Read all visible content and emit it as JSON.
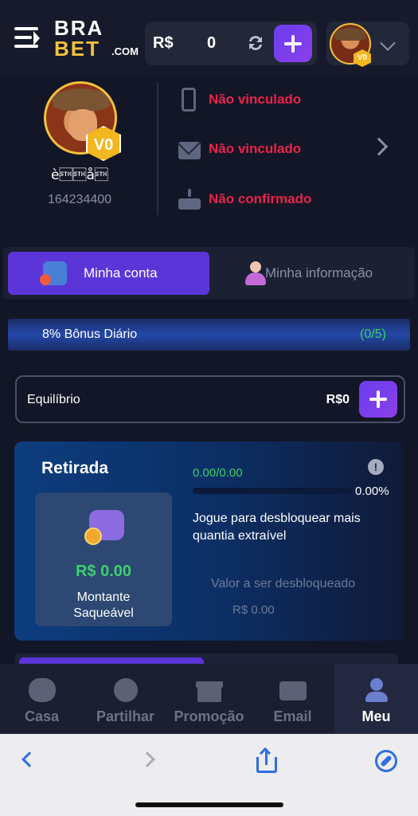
{
  "header": {
    "logo_line1": "BRA",
    "logo_line2": "BET",
    "logo_suffix": ".COM",
    "currency": "R$",
    "balance": "0",
    "vip_badge": "V0"
  },
  "profile": {
    "username": "è\u0002\u0002å\u0002",
    "user_id": "164234400",
    "vip_badge": "V0",
    "phone_status": "Não vinculado",
    "email_status": "Não vinculado",
    "birthday_status": "Não confirmado"
  },
  "tabs": [
    {
      "label": "Minha conta",
      "active": true
    },
    {
      "label": "Minha informação",
      "active": false
    }
  ],
  "bonus": {
    "label": "8% Bônus Diário",
    "progress": "(0/5)"
  },
  "balance_row": {
    "label": "Equilíbrio",
    "value": "R$0"
  },
  "withdrawal": {
    "title": "Retirada",
    "amount": "R$ 0.00",
    "amount_caption": "Montante Saqueável",
    "progress_text": "0.00/0.00",
    "progress_percent": "0.00%",
    "description": "Jogue para desbloquear mais quantia extraível",
    "unlock_label": "Valor a ser desbloqueado",
    "unlock_value": "R$ 0.00"
  },
  "bottom_nav": [
    {
      "label": "Casa",
      "icon": "gamepad-icon"
    },
    {
      "label": "Partilhar",
      "icon": "share-icon"
    },
    {
      "label": "Promoção",
      "icon": "gift-icon"
    },
    {
      "label": "Email",
      "icon": "mail-icon"
    },
    {
      "label": "Meu",
      "icon": "user-icon",
      "active": true
    }
  ],
  "colors": {
    "accent": "#5b35d8",
    "alert": "#e8244a",
    "success": "#3ad16a",
    "gold": "#f1c23b"
  }
}
